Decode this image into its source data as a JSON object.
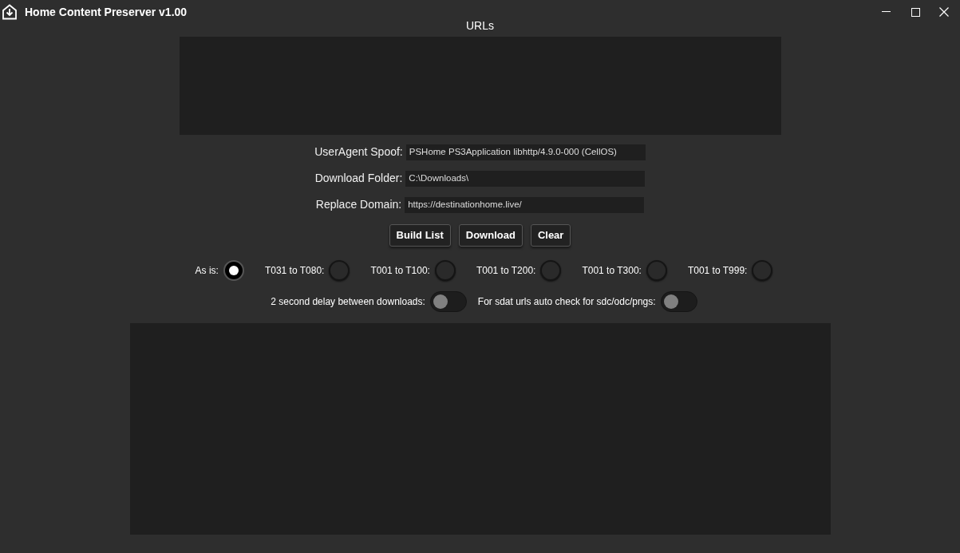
{
  "window": {
    "title": "Home Content Preserver v1.00"
  },
  "urls": {
    "label": "URLs"
  },
  "fields": [
    {
      "label": "UserAgent Spoof:",
      "value": "PSHome PS3Application libhttp/4.9.0-000 (CellOS)"
    },
    {
      "label": "Download Folder:",
      "value": "C:\\Downloads\\"
    },
    {
      "label": "Replace Domain:",
      "value": "https://destinationhome.live/"
    }
  ],
  "buttons": [
    "Build List",
    "Download",
    "Clear"
  ],
  "radios": [
    {
      "label": "As is:",
      "selected": true
    },
    {
      "label": "T031 to T080:",
      "selected": false
    },
    {
      "label": "T001 to T100:",
      "selected": false
    },
    {
      "label": "T001 to T200:",
      "selected": false
    },
    {
      "label": "T001 to T300:",
      "selected": false
    },
    {
      "label": "T001 to T999:",
      "selected": false
    }
  ],
  "toggles": [
    {
      "label": "2 second delay between downloads:",
      "on": false
    },
    {
      "label": "For sdat urls auto check for sdc/odc/pngs:",
      "on": false
    }
  ]
}
